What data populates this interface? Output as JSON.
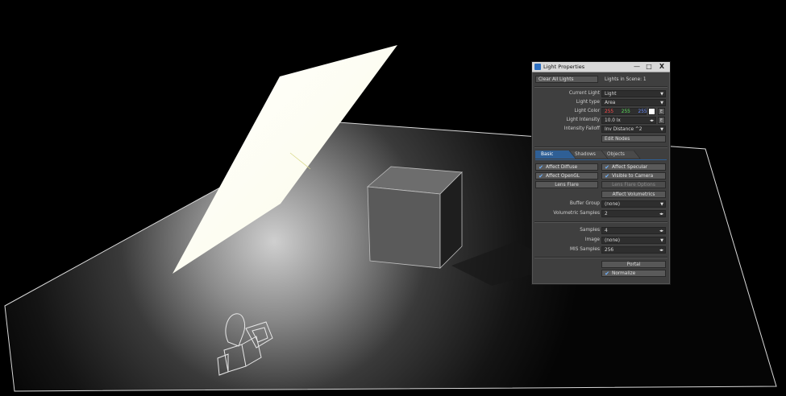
{
  "window": {
    "title": "Light Properties",
    "controls": {
      "minimize": "—",
      "maximize": "□",
      "close": "X"
    }
  },
  "top": {
    "clear_all": "Clear All Lights",
    "lights_in_scene": "Lights in Scene: 1"
  },
  "props": {
    "current_light_label": "Current Light",
    "current_light_value": "Light",
    "light_type_label": "Light type",
    "light_type_value": "Area",
    "light_color_label": "Light Color",
    "color_r": "255",
    "color_g": "255",
    "color_b": "255",
    "color_r_hex": "#ff4a4a",
    "color_g_hex": "#5ae05a",
    "color_b_hex": "#6a8cff",
    "light_intensity_label": "Light Intensity",
    "light_intensity_value": "10.0 lx",
    "falloff_label": "Intensity Falloff",
    "falloff_value": "Inv Distance ^2",
    "edit_nodes": "Edit Nodes"
  },
  "tabs": [
    "Basic",
    "Shadows",
    "Objects"
  ],
  "basic": {
    "affect_diffuse": "Affect Diffuse",
    "affect_specular": "Affect Specular",
    "affect_opengl": "Affect OpenGL",
    "visible_to_camera": "Visible to Camera",
    "lens_flare": "Lens Flare",
    "lens_flare_options": "Lens Flare Options",
    "affect_volumetrics": "Affect Volumetrics",
    "buffer_group_label": "Buffer Group",
    "buffer_group_value": "(none)",
    "volumetric_samples_label": "Volumetric Samples",
    "volumetric_samples_value": "2",
    "samples_label": "Samples",
    "samples_value": "4",
    "image_label": "Image",
    "image_value": "(none)",
    "mis_samples_label": "MIS Samples",
    "mis_samples_value": "256",
    "portal": "Portal",
    "normalize": "Normalize"
  },
  "icons": [
    "app-icon",
    "dropdown-caret-icon",
    "stepper-icon",
    "checkbox-check-icon",
    "color-swatch-icon",
    "envelope-icon"
  ]
}
